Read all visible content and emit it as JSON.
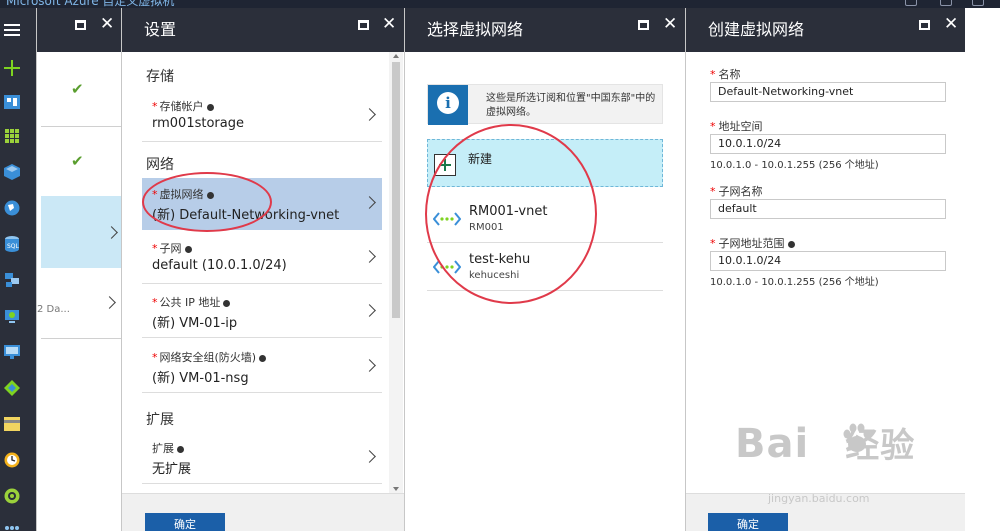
{
  "topbar": {
    "text": "Microsoft Azure 自定义虚拟机"
  },
  "rail": {
    "icons": [
      "hamburger-icon",
      "plus-icon",
      "dashboard-icon",
      "grid-icon",
      "cube-icon",
      "globe-icon",
      "sql-icon",
      "vm-icon",
      "gear-icon",
      "monitor-icon",
      "diamond-icon",
      "card-icon",
      "clock-icon",
      "circle-icon",
      "more-icon"
    ]
  },
  "blade_list": {
    "truncated_item": "2 Da..."
  },
  "blade_settings": {
    "title": "设置",
    "sections": {
      "storage": "存储",
      "network": "网络",
      "extensions": "扩展"
    },
    "fields": {
      "storage_account": {
        "label": "存储帐户",
        "value": "rm001storage"
      },
      "vnet": {
        "label": "虚拟网络",
        "value": "(新) Default-Networking-vnet"
      },
      "subnet": {
        "label": "子网",
        "value": "default (10.0.1.0/24)"
      },
      "public_ip": {
        "label": "公共 IP 地址",
        "value": "(新) VM-01-ip"
      },
      "nsg": {
        "label": "网络安全组(防火墙)",
        "value": "(新) VM-01-nsg"
      },
      "extensions": {
        "label": "扩展",
        "value": "无扩展"
      }
    },
    "ok_label": "确定"
  },
  "blade_select_vnet": {
    "title": "选择虚拟网络",
    "info_text": "这些是所选订阅和位置\"中国东部\"中的虚拟网络。",
    "new_label": "新建",
    "networks": [
      {
        "name": "RM001-vnet",
        "sub": "RM001"
      },
      {
        "name": "test-kehu",
        "sub": "kehuceshi"
      }
    ]
  },
  "blade_create_vnet": {
    "title": "创建虚拟网络",
    "name_label": "名称",
    "name_value": "Default-Networking-vnet",
    "address_label": "地址空间",
    "address_value": "10.0.1.0/24",
    "address_hint": "10.0.1.0 - 10.0.1.255 (256 个地址)",
    "subnet_name_label": "子网名称",
    "subnet_name_value": "default",
    "subnet_range_label": "子网地址范围",
    "subnet_range_value": "10.0.1.0/24",
    "subnet_range_hint": "10.0.1.0 - 10.0.1.255 (256 个地址)",
    "ok_label": "确定"
  },
  "watermark": {
    "brand": "Bai",
    "brand2": "经验",
    "url": "jingyan.baidu.com"
  },
  "colors": {
    "accent": "#1b5fa8",
    "highlight": "#b7cde8",
    "selected": "#c5eef8",
    "ring": "#e03a4a",
    "header": "#2b2f3a"
  }
}
